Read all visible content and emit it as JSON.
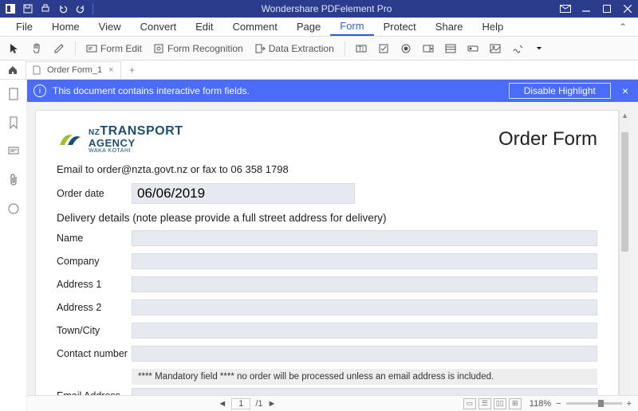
{
  "app": {
    "title": "Wondershare PDFelement Pro"
  },
  "menu": {
    "items": [
      "File",
      "Home",
      "View",
      "Convert",
      "Edit",
      "Comment",
      "Page",
      "Form",
      "Protect",
      "Share",
      "Help"
    ],
    "active": "Form"
  },
  "toolbar": {
    "form_edit": "Form Edit",
    "form_recognition": "Form Recognition",
    "data_extraction": "Data Extraction"
  },
  "tabs": {
    "doc_name": "Order Form_1"
  },
  "notice": {
    "text": "This document contains interactive form fields.",
    "disable": "Disable Highlight"
  },
  "document": {
    "logo": {
      "nz": "NZ",
      "transport": "TRANSPORT",
      "agency": "AGENCY",
      "waka": "WAKA KOTAHI"
    },
    "title": "Order Form",
    "email_line": "Email to order@nzta.govt.nz or fax to 06 358 1798",
    "order_date_label": "Order date",
    "order_date_value": "06/06/2019",
    "delivery_heading": "Delivery details (note please provide a full street address for delivery)",
    "fields": {
      "name": "Name",
      "company": "Company",
      "address1": "Address 1",
      "address2": "Address 2",
      "town": "Town/City",
      "contact": "Contact number",
      "email": "Email Address"
    },
    "mandatory_notice": "**** Mandatory field **** no order will be processed unless an email address is included."
  },
  "status": {
    "page_current": "1",
    "page_total": "/1",
    "zoom": "118%"
  }
}
